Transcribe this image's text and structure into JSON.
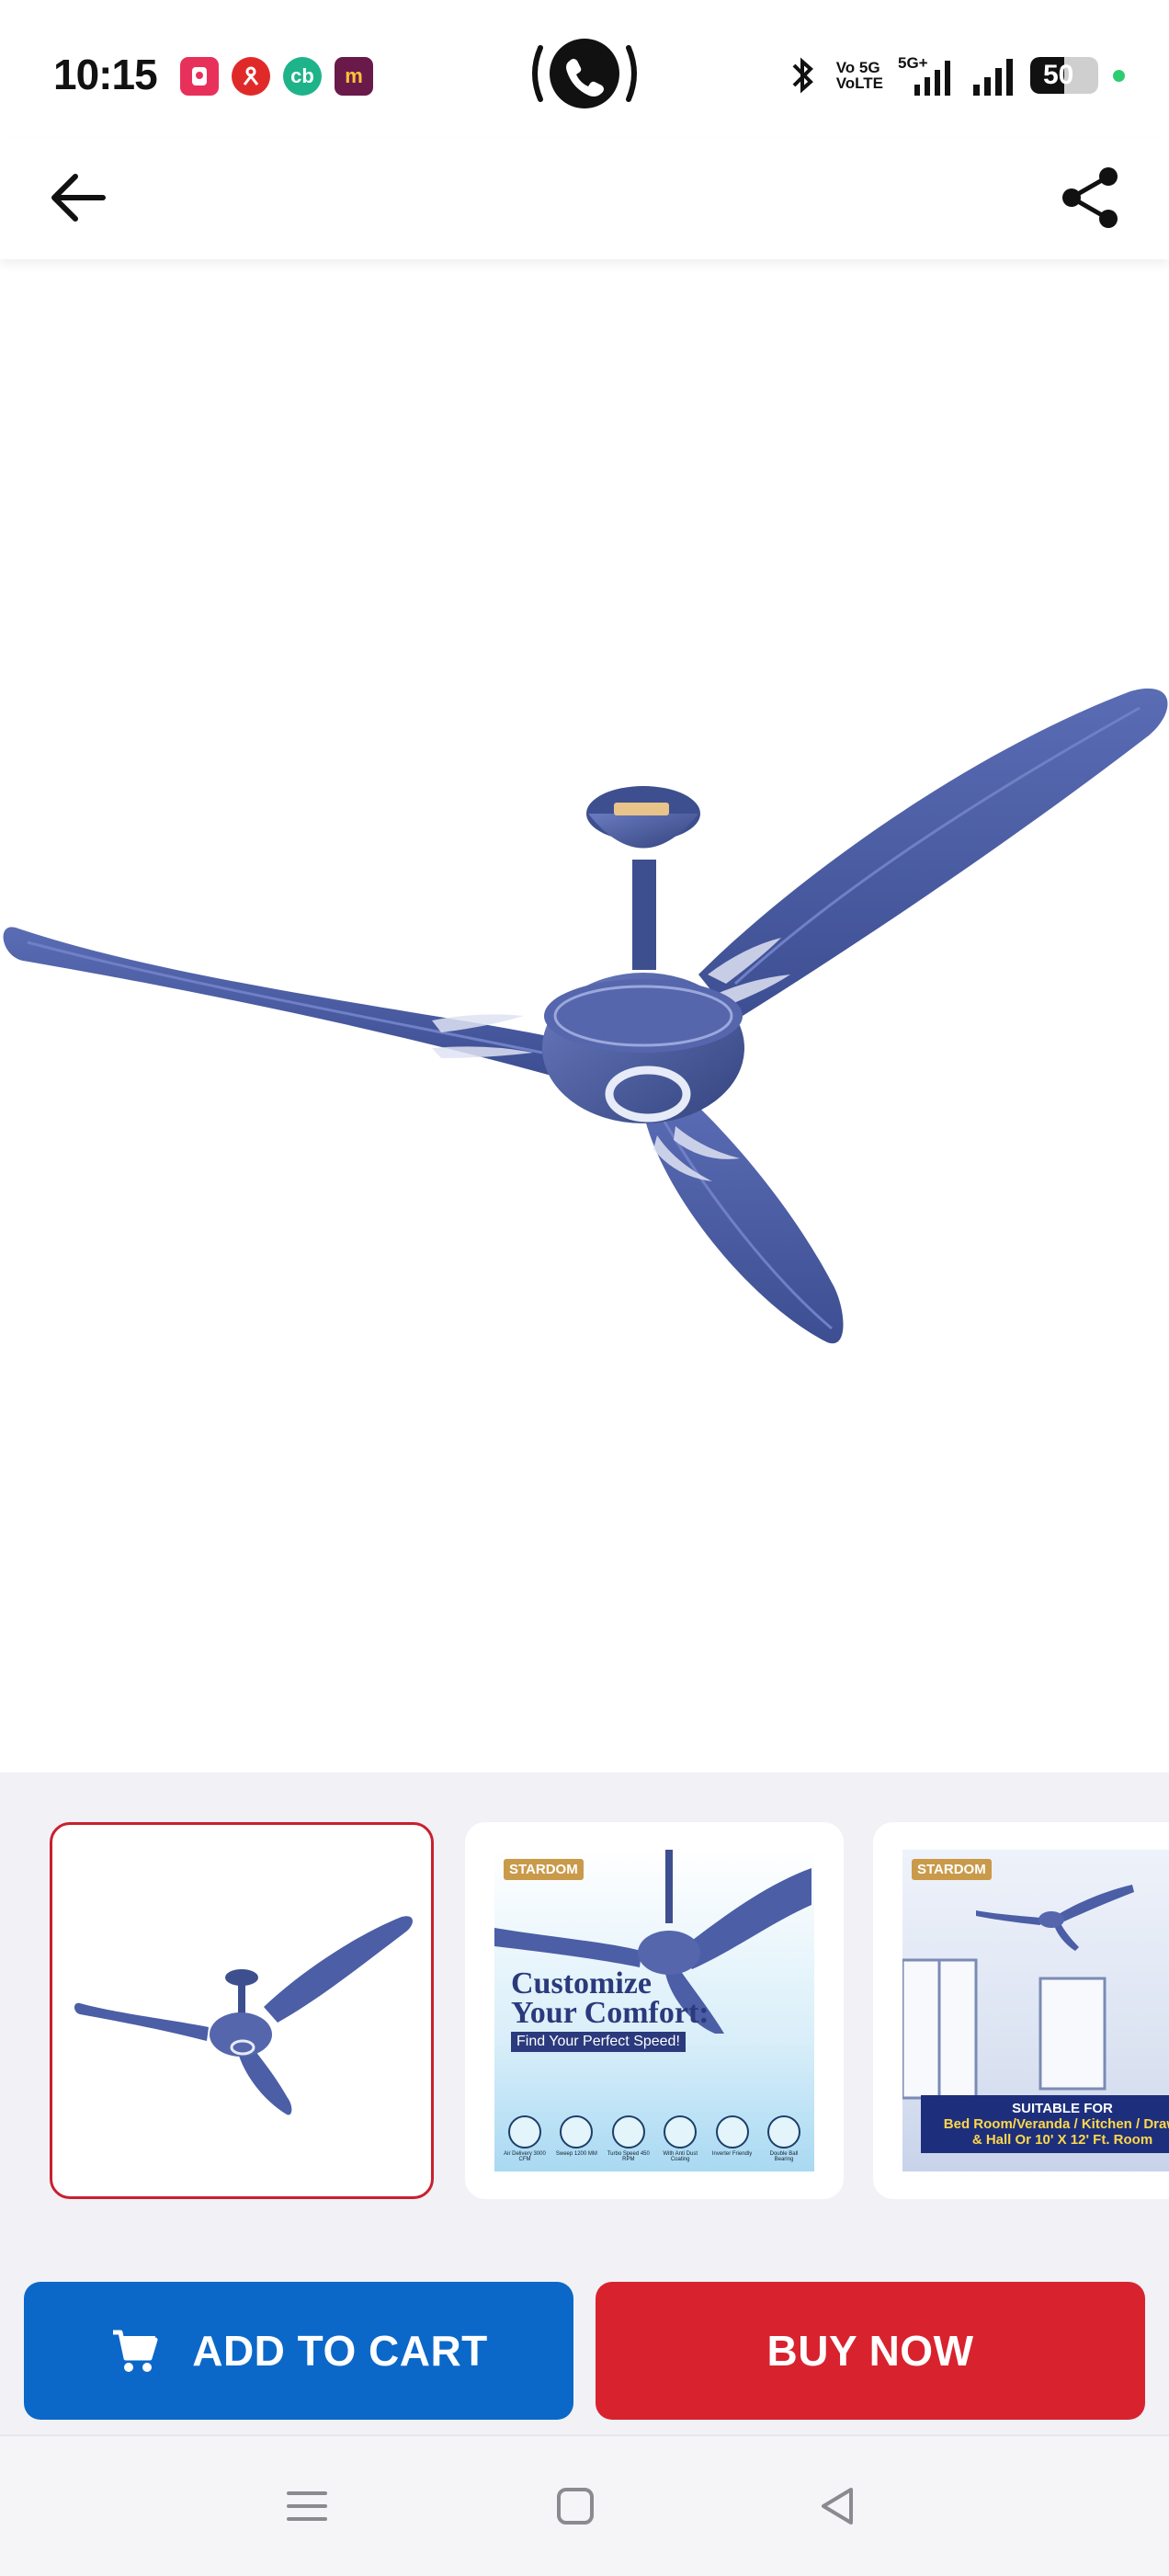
{
  "status_bar": {
    "time": "10:15",
    "apps": [
      {
        "icon": "snapdeal-app-icon",
        "label": "s",
        "color": "#e8315a"
      },
      {
        "icon": "person-app-icon",
        "label": "",
        "color": "#e02a2a"
      },
      {
        "icon": "cb-app-icon",
        "label": "cb",
        "color": "#1fb38a"
      },
      {
        "icon": "mandra-app-icon",
        "label": "m",
        "color": "#6a1a4a"
      }
    ],
    "call_icon": "phone-call-icon",
    "network_line1": "Vo 5G",
    "network_line2": "VoLTE",
    "network_5g": "5G+",
    "battery_level": "50",
    "battery_fraction": 0.5
  },
  "header": {
    "back_icon": "arrow-left-icon",
    "share_icon": "share-icon"
  },
  "product": {
    "brand_badge": "STARDOM",
    "colors": {
      "fan_blue": "#4b5ea6",
      "fan_blue_dark": "#3a4b8c"
    }
  },
  "thumbnails": [
    {
      "name": "thumb-fan",
      "selected": true
    },
    {
      "name": "thumb-customize",
      "selected": false,
      "badge": "STARDOM",
      "title1": "Customize",
      "title2": "Your Comfort:",
      "tagline": "Find Your Perfect Speed!",
      "features": [
        "Air Delivery 3000 CFM",
        "Sweep 1200 MM",
        "Turbo Speed 450 RPM",
        "With Anti Dust Coating",
        "Inverter Friendly",
        "Double Ball Bearing"
      ]
    },
    {
      "name": "thumb-rooms",
      "selected": false,
      "badge": "STARDOM",
      "suitable": "SUITABLE FOR",
      "rooms_line1": "Bed Room/Veranda / Kitchen / Drawi",
      "rooms_line2": "& Hall Or 10' X 12' Ft. Room"
    }
  ],
  "actions": {
    "add_to_cart": "ADD TO CART",
    "buy_now": "BUY NOW",
    "cart_color": "#0b68c8",
    "buy_color": "#d8232f"
  },
  "nav": {
    "menu_icon": "menu-icon",
    "home_icon": "home-square-icon",
    "back_icon": "back-triangle-icon"
  }
}
